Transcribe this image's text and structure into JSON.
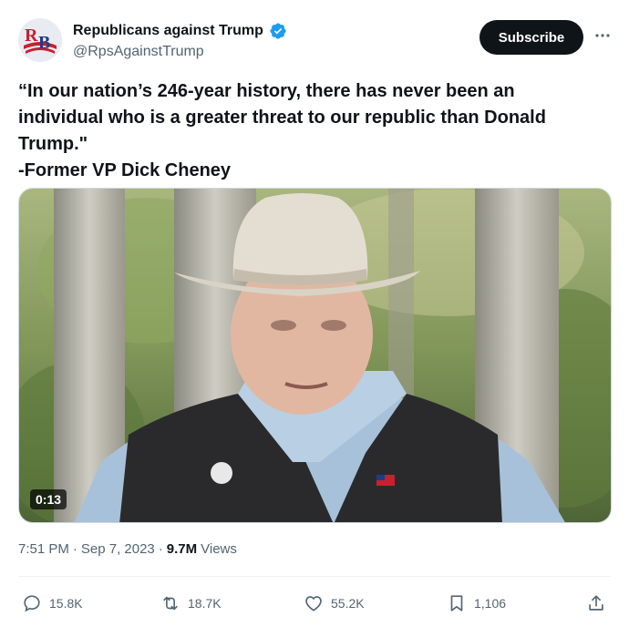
{
  "author": {
    "name": "Republicans against Trump",
    "handle": "@RpsAgainstTrump",
    "avatar_letters": "RB",
    "verified_color": "#1d9bf0"
  },
  "header": {
    "subscribe_label": "Subscribe",
    "more_icon": "more-horizontal-icon"
  },
  "tweet": {
    "text": "“In our nation’s 246-year history, there has never been an individual who is a greater threat to our republic than Donald Trump.\"\n-Former VP Dick Cheney"
  },
  "media": {
    "duration": "0:13"
  },
  "meta": {
    "time": "7:51 PM",
    "separator": "·",
    "date": "Sep 7, 2023",
    "views_count": "9.7M",
    "views_label": "Views"
  },
  "actions": {
    "replies": "15.8K",
    "reposts": "18.7K",
    "likes": "55.2K",
    "bookmarks": "1,106"
  },
  "colors": {
    "text_primary": "#0f1419",
    "text_secondary": "#536471",
    "verified": "#1d9bf0",
    "button": "#0f1419"
  }
}
